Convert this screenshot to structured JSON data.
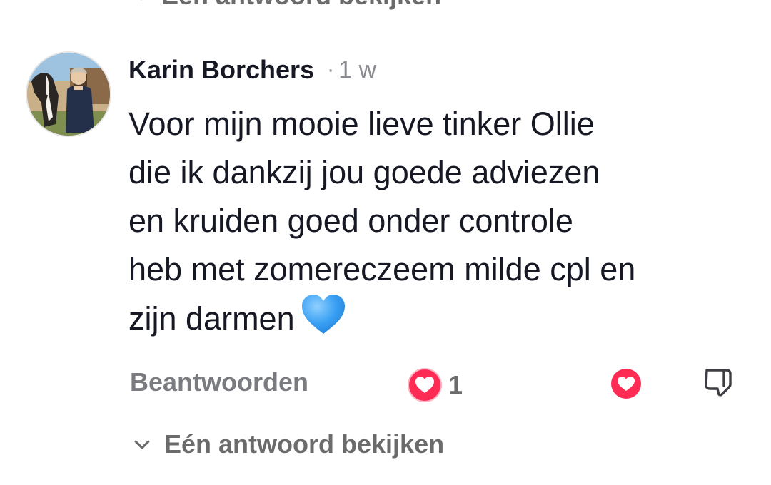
{
  "top_partial": {
    "label": "Eén antwoord bekijken"
  },
  "comment": {
    "author": "Karin Borchers",
    "separator": "·",
    "time": "1 w",
    "text_lines": [
      "Voor mijn mooie lieve tinker Ollie",
      "die ik dankzij jou goede adviezen",
      "en kruiden goed onder controle",
      "heb met zomereczeem milde cpl en",
      "zijn  darmen"
    ],
    "emoji": "blue-heart-emoji",
    "actions": {
      "reply_label": "Beantwoorden",
      "creator_like_count": "1",
      "like_icon": "heart-icon",
      "dislike_icon": "thumbs-down-icon"
    },
    "view_replies_label": "Eén antwoord bekijken"
  },
  "colors": {
    "text_primary": "#161823",
    "text_secondary": "#7a7b80",
    "like_red": "#fe2c55",
    "emoji_blue": "#3aa0f3"
  }
}
